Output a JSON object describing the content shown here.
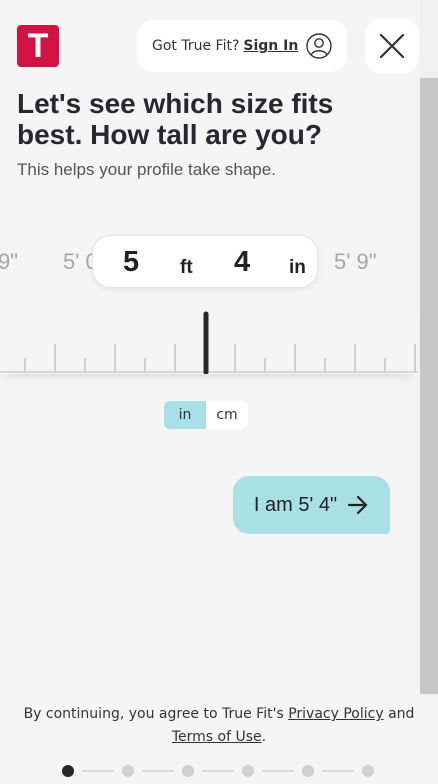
{
  "logo": {
    "letter": "T",
    "color": "#d11243"
  },
  "header": {
    "signin_prompt": "Got True Fit?",
    "signin_link": "Sign In",
    "user_icon": "user-circle-icon",
    "close_icon": "close-icon"
  },
  "main": {
    "headline_line1": "Let's see which size fits",
    "headline_line2": "best. How tall are you?",
    "subline": "This helps your profile take shape."
  },
  "height_picker": {
    "left_value_far": "9\"",
    "left_value_near": "5' 0",
    "feet": "5",
    "feet_unit": "ft",
    "inches": "4",
    "inches_unit": "in",
    "right_value": "5' 9\""
  },
  "unit_toggle": {
    "options": [
      "in",
      "cm"
    ],
    "selected": "in",
    "accent": "#a8e0e6"
  },
  "confirm": {
    "label": "I am 5' 4\"",
    "icon": "arrow-right-icon"
  },
  "footer": {
    "prefix": "By continuing, you agree to True Fit's ",
    "privacy_link": "Privacy Policy",
    "conjunction": " and",
    "terms_link": "Terms of Use",
    "suffix": "."
  },
  "progress": {
    "total_steps": 6,
    "current_step": 1
  }
}
